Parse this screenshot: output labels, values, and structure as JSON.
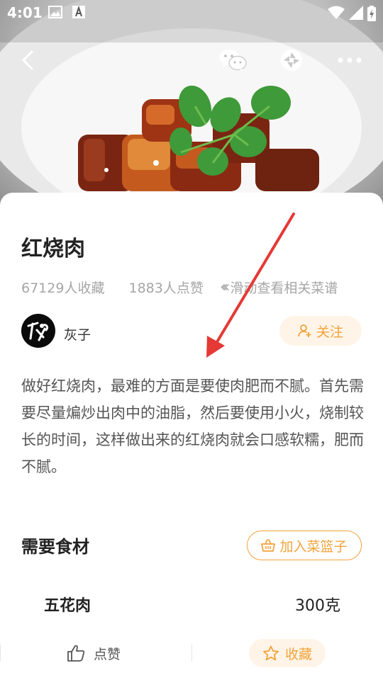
{
  "status_bar": {
    "time": "4:01"
  },
  "recipe": {
    "title": "红烧肉",
    "favorites_count": "67129人收藏",
    "likes_count": "1883人点赞",
    "swipe_hint": "滑动查看相关菜谱",
    "author": {
      "name": "灰子"
    },
    "follow_label": "关注",
    "description": "做好红烧肉，最难的方面是要使肉肥而不腻。首先需要尽量煸炒出肉中的油脂，然后要使用小火，烧制较长的时间，这样做出来的红烧肉就会口感软糯，肥而不腻。"
  },
  "ingredients": {
    "section_title": "需要食材",
    "add_basket_label": "加入菜篮子",
    "items": [
      {
        "name": "五花肉",
        "amount": "300克"
      }
    ]
  },
  "bottom_bar": {
    "like_label": "点赞",
    "collect_label": "收藏"
  },
  "icons": {
    "back": "back-arrow-icon",
    "wechat": "wechat-icon",
    "moments": "moments-icon",
    "more": "more-icon"
  },
  "colors": {
    "accent": "#f2a33a",
    "accent_bg": "#fff4e7",
    "annotation_arrow": "#e53935"
  }
}
